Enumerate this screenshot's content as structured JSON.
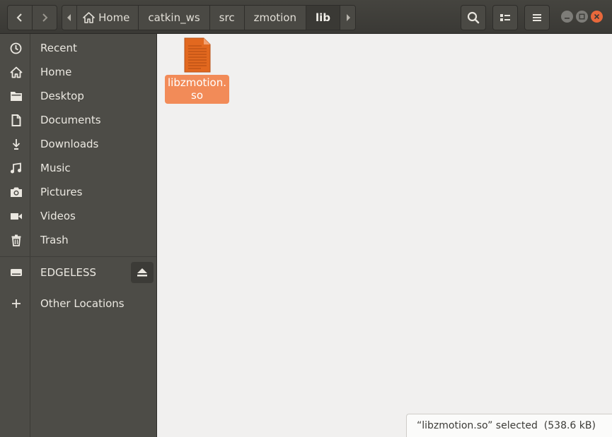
{
  "header": {
    "breadcrumbs": [
      "Home",
      "catkin_ws",
      "src",
      "zmotion",
      "lib"
    ],
    "current": "lib"
  },
  "sidebar": {
    "items": [
      {
        "label": "Recent",
        "icon": "clock-icon"
      },
      {
        "label": "Home",
        "icon": "home-icon"
      },
      {
        "label": "Desktop",
        "icon": "folder-icon"
      },
      {
        "label": "Documents",
        "icon": "document-icon"
      },
      {
        "label": "Downloads",
        "icon": "download-icon"
      },
      {
        "label": "Music",
        "icon": "music-icon"
      },
      {
        "label": "Pictures",
        "icon": "camera-icon"
      },
      {
        "label": "Videos",
        "icon": "video-icon"
      },
      {
        "label": "Trash",
        "icon": "trash-icon"
      }
    ],
    "devices": [
      {
        "label": "EDGELESS",
        "icon": "drive-icon"
      }
    ],
    "other": {
      "label": "Other Locations",
      "icon": "plus-icon"
    }
  },
  "files": [
    {
      "name_line1": "libzmotion.",
      "name_line2": "so",
      "selected": true
    }
  ],
  "status": {
    "text": "“libzmotion.so” selected  (538.6 kB)"
  },
  "colors": {
    "accent": "#f28b58",
    "close": "#e8683b",
    "sidebar": "#4d4c47",
    "header": "#3c3b37"
  }
}
